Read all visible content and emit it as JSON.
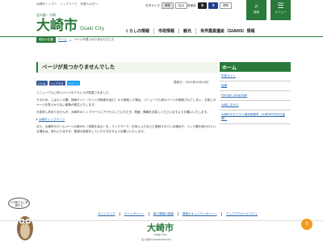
{
  "header": {
    "top_links": [
      "大崎市トップへ",
      "トップページ",
      "外国人の方へ",
      "サイトマップ"
    ],
    "text_size_label": "文字サイズ",
    "text_size_normal": "標準",
    "text_size_large": "拡大",
    "bg_color_label": "背景色",
    "bg_black": "黒",
    "bg_blue": "青",
    "bg_standard": "標準",
    "search_label": "検索",
    "menu_label": "メニュー",
    "logo_sub": "宝の都・大崎",
    "logo_kanji": "大崎市",
    "logo_en": "Osaki City"
  },
  "global_nav": [
    "くらしの情報",
    "市政情報",
    "観光",
    "世界農業遺産（GIAHS）情報"
  ],
  "breadcrumb": {
    "here_label": "現在の位置",
    "home": "ホーム",
    "sep": ">",
    "current": "ページが見つかりませんでした"
  },
  "main": {
    "title": "ページが見つかりませんでした",
    "share": [
      {
        "label": "いいね",
        "color": "#3b5998"
      },
      {
        "label": "シェアする",
        "color": "#3b5998"
      },
      {
        "label": "ツイート",
        "color": "#1da1f2"
      }
    ],
    "updated": "更新日：2021年02月26日",
    "paragraphs": [
      "リニューアルに伴いページのアドレスが変更されました。",
      "そのため、しばらくの間、検索サイト（サイト内検索を含む）から検索した場合、リニューアル前のページが検索されてしまい、お探しのページを見つからない事象が発生いたします。",
      "大変申し訳ありませんが、大崎市のトップページにアクセスしていただき、再度、情報をお探しくださいますようお願いいたします。",
      "また、大崎市のホームページの新URL（末尾を含む）を、ブックマーク・お気に入りなどに登録されている場合や、リンク集を設けれている場合は、恐れ入りますが、登録の変更をしていただきますようお願いいたします。"
    ],
    "top_link": "大崎市トップページ"
  },
  "sidebar": {
    "heading": "ホーム",
    "items": [
      "市政サイト",
      "組織",
      "Foreign Language",
      "大崎しまから",
      "大崎市おおさき人事評価基準（大崎市市内在住者等）"
    ]
  },
  "footer": {
    "nav": [
      "サイトマップ",
      "サイトポリシー",
      "個人情報の保護",
      "情報セキュリティポリシー",
      "ウェブアクセシビリティ"
    ],
    "logo_kanji": "大崎市",
    "logo_en": "Osaki City",
    "address": "法人番号1000020042153",
    "mascot_text": "パラ崎さんに質問する",
    "totop": "↑"
  }
}
